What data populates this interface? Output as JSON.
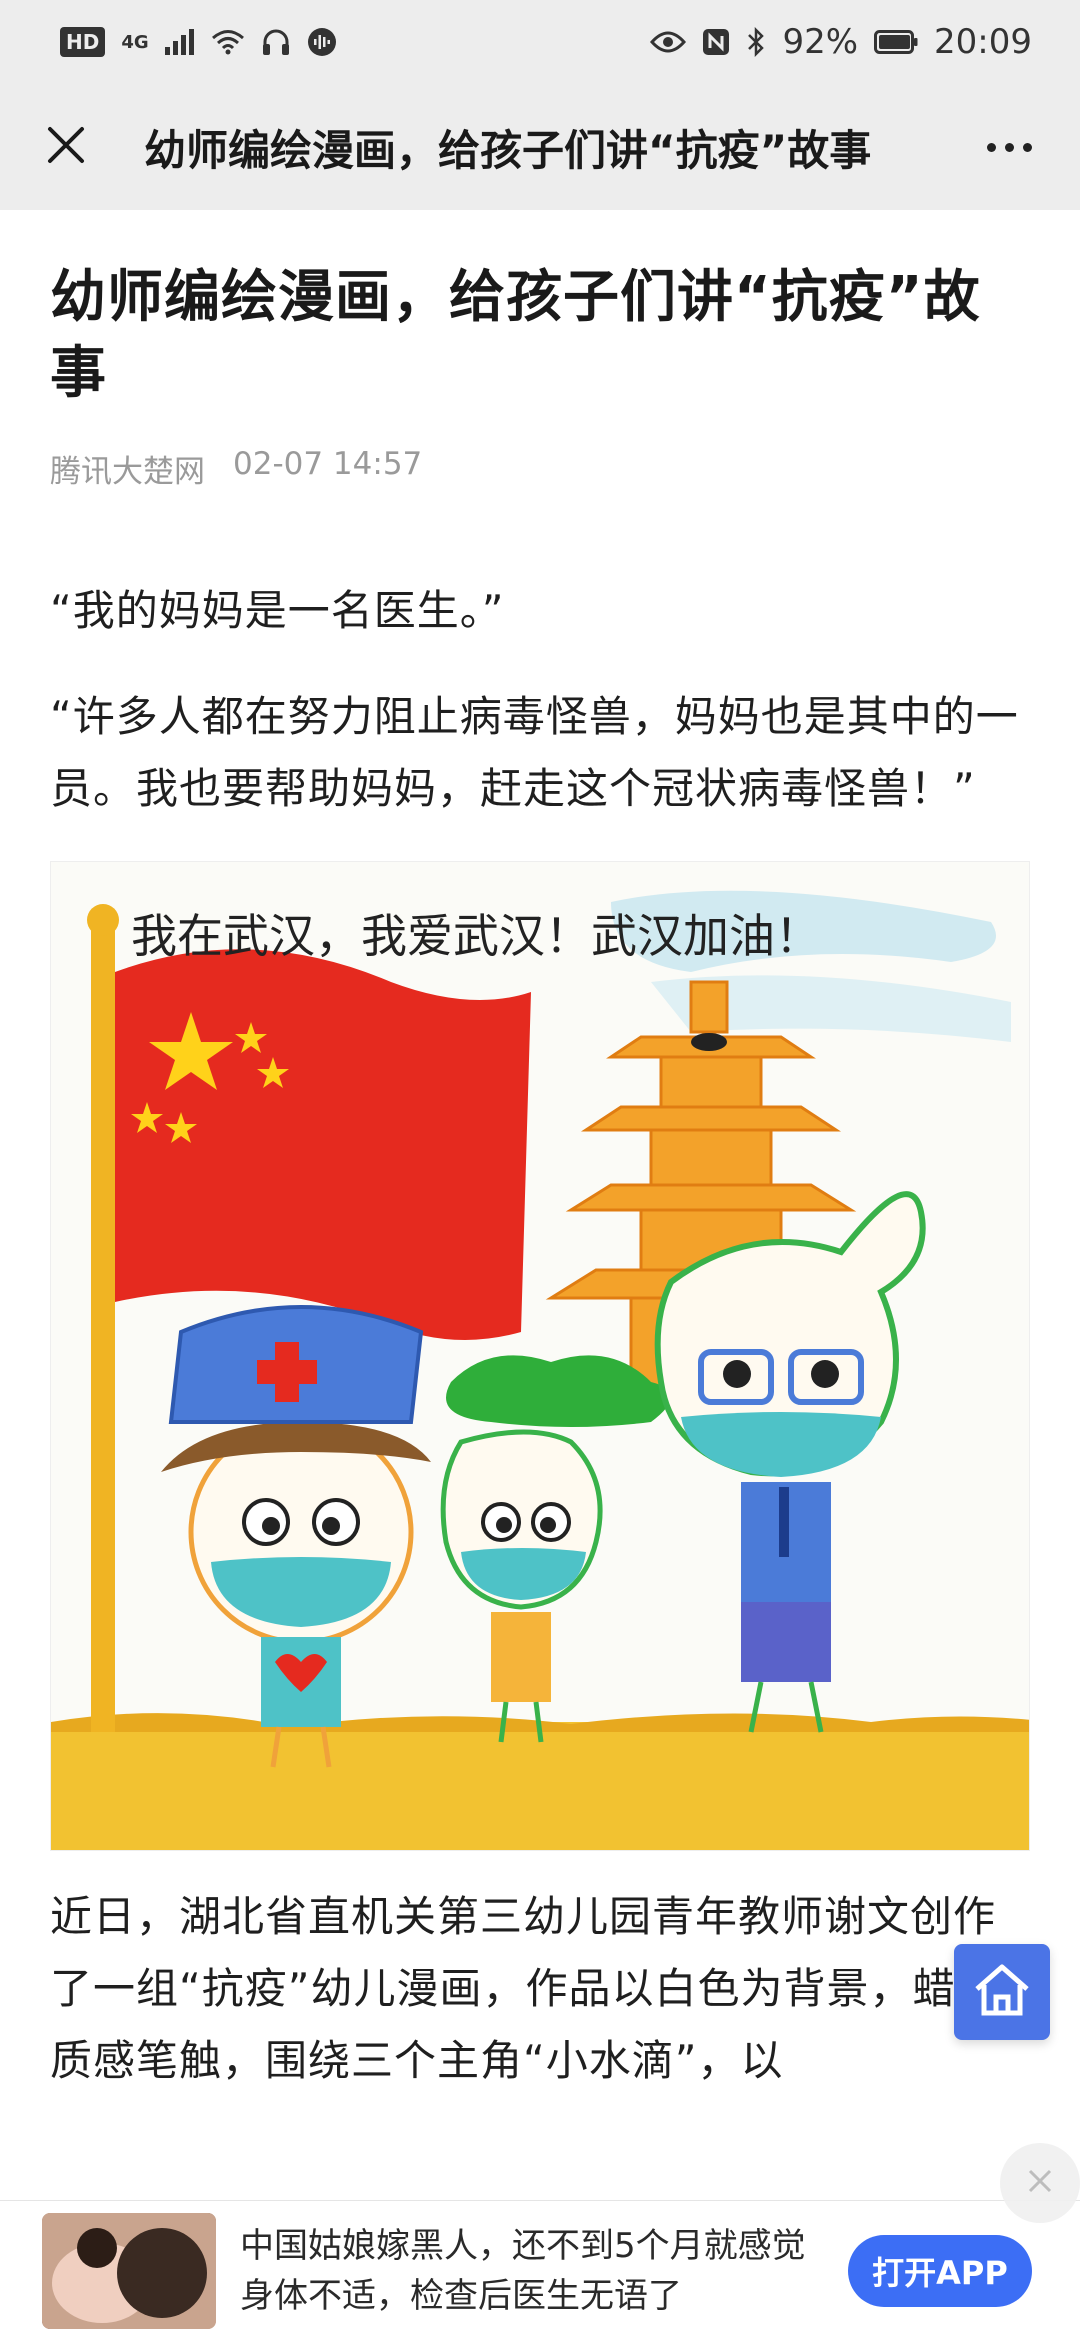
{
  "status_bar": {
    "hd": "HD",
    "network": "4G",
    "battery": "92%",
    "time": "20:09"
  },
  "nav": {
    "title": "幼师编绘漫画，给孩子们讲“抗疫”故事"
  },
  "article": {
    "title": "幼师编绘漫画，给孩子们讲“抗疫”故事",
    "source": "腾讯大楚网",
    "datetime": "02-07 14:57",
    "paragraph1": "“我的妈妈是一名医生。”",
    "paragraph2": "“许多人都在努力阻止病毒怪兽，妈妈也是其中的一员。我也要帮助妈妈，赶走这个冠状病毒怪兽！”",
    "figure_caption_text": "我在武汉，我爱武汉！武汉加油！",
    "paragraph3": "近日，湖北省直机关第三幼儿园青年教师谢文创作了一组“抗疫”幼儿漫画，作品以白色为背景，蜡笔质感笔触，围绕三个主角“小水滴”，以"
  },
  "ad": {
    "text": "中国姑娘嫁黑人，还不到5个月就感觉身体不适，检查后医生无语了",
    "button": "打开APP"
  },
  "icons": {
    "close": "close-icon",
    "more": "more-icon",
    "home": "home-icon"
  },
  "colors": {
    "bar_bg": "#ededed",
    "accent": "#3c6ef5",
    "home_btn": "#4b74e6"
  }
}
